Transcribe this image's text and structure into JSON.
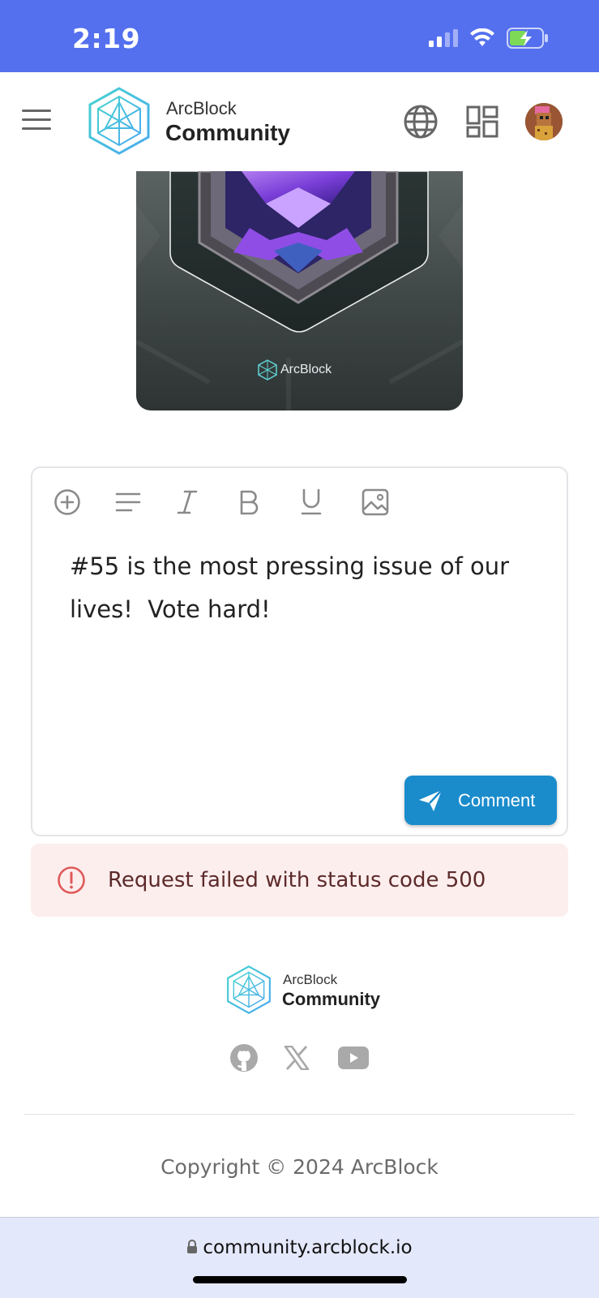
{
  "status_bar": {
    "time": "2:19",
    "bg_color": "#5470ef"
  },
  "header": {
    "brand_top": "ArcBlock",
    "brand_bottom": "Community",
    "icons": [
      "menu-icon",
      "globe-icon",
      "apps-grid-icon",
      "user-avatar"
    ]
  },
  "badge_image": {
    "label": "ArcBlock"
  },
  "editor": {
    "toolbar": [
      "add-icon",
      "align-icon",
      "italic-icon",
      "bold-icon",
      "underline-icon",
      "image-icon"
    ],
    "text": "#55 is the most pressing issue of our lives!  Vote hard!",
    "submit_label": "Comment",
    "submit_color": "#1a8ccc"
  },
  "alert": {
    "message": "Request failed with status code 500",
    "bg_color": "#fdeeee"
  },
  "footer": {
    "brand_top": "ArcBlock",
    "brand_bottom": "Community",
    "social": [
      "github-icon",
      "x-icon",
      "youtube-icon"
    ],
    "copyright": "Copyright © 2024 ArcBlock"
  },
  "browser": {
    "url": "community.arcblock.io"
  }
}
